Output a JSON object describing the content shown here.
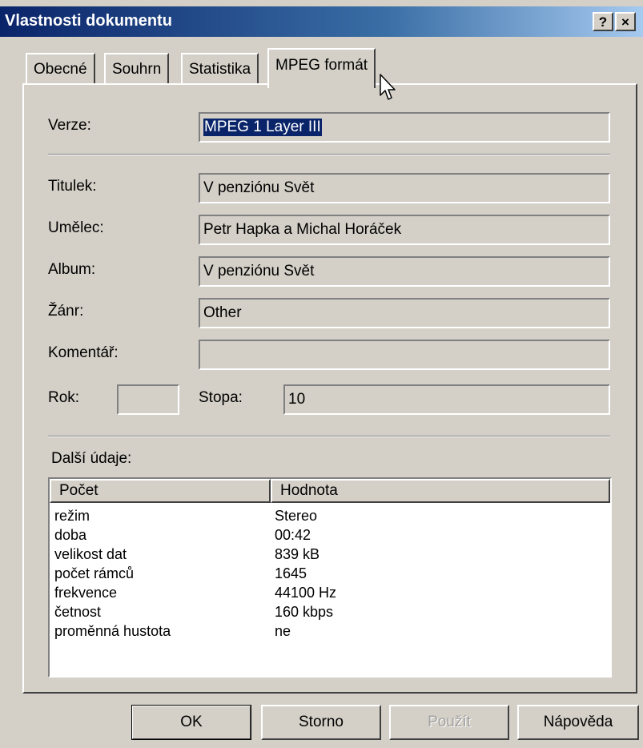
{
  "window": {
    "title": "Vlastnosti dokumentu",
    "help_glyph": "?",
    "close_glyph": "×"
  },
  "tabs": [
    {
      "label": "Obecné",
      "active": false
    },
    {
      "label": "Souhrn",
      "active": false
    },
    {
      "label": "Statistika",
      "active": false
    },
    {
      "label": "MPEG formát",
      "active": true
    }
  ],
  "fields": {
    "verze": {
      "label": "Verze:",
      "value": "MPEG 1 Layer III"
    },
    "titulek": {
      "label": "Titulek:",
      "value": "V penziónu Svět"
    },
    "umelec": {
      "label": "Umělec:",
      "value": "Petr Hapka a Michal Horáček"
    },
    "album": {
      "label": "Album:",
      "value": "V penziónu Svět"
    },
    "zanr": {
      "label": "Žánr:",
      "value": "Other"
    },
    "komentar": {
      "label": "Komentář:",
      "value": ""
    },
    "rok": {
      "label": "Rok:",
      "value": ""
    },
    "stopa": {
      "label": "Stopa:",
      "value": "10"
    }
  },
  "details": {
    "label": "Další údaje:",
    "columns": [
      "Počet",
      "Hodnota"
    ],
    "rows": [
      {
        "name": "režim",
        "value": "Stereo"
      },
      {
        "name": "doba",
        "value": "00:42"
      },
      {
        "name": "velikost dat",
        "value": "839 kB"
      },
      {
        "name": "počet rámců",
        "value": "1645"
      },
      {
        "name": "frekvence",
        "value": "44100 Hz"
      },
      {
        "name": "četnost",
        "value": "160 kbps"
      },
      {
        "name": "proměnná hustota",
        "value": "ne"
      }
    ]
  },
  "buttons": {
    "ok": "OK",
    "storno": "Storno",
    "pouzit": "Použít",
    "napoveda": "Nápověda"
  }
}
